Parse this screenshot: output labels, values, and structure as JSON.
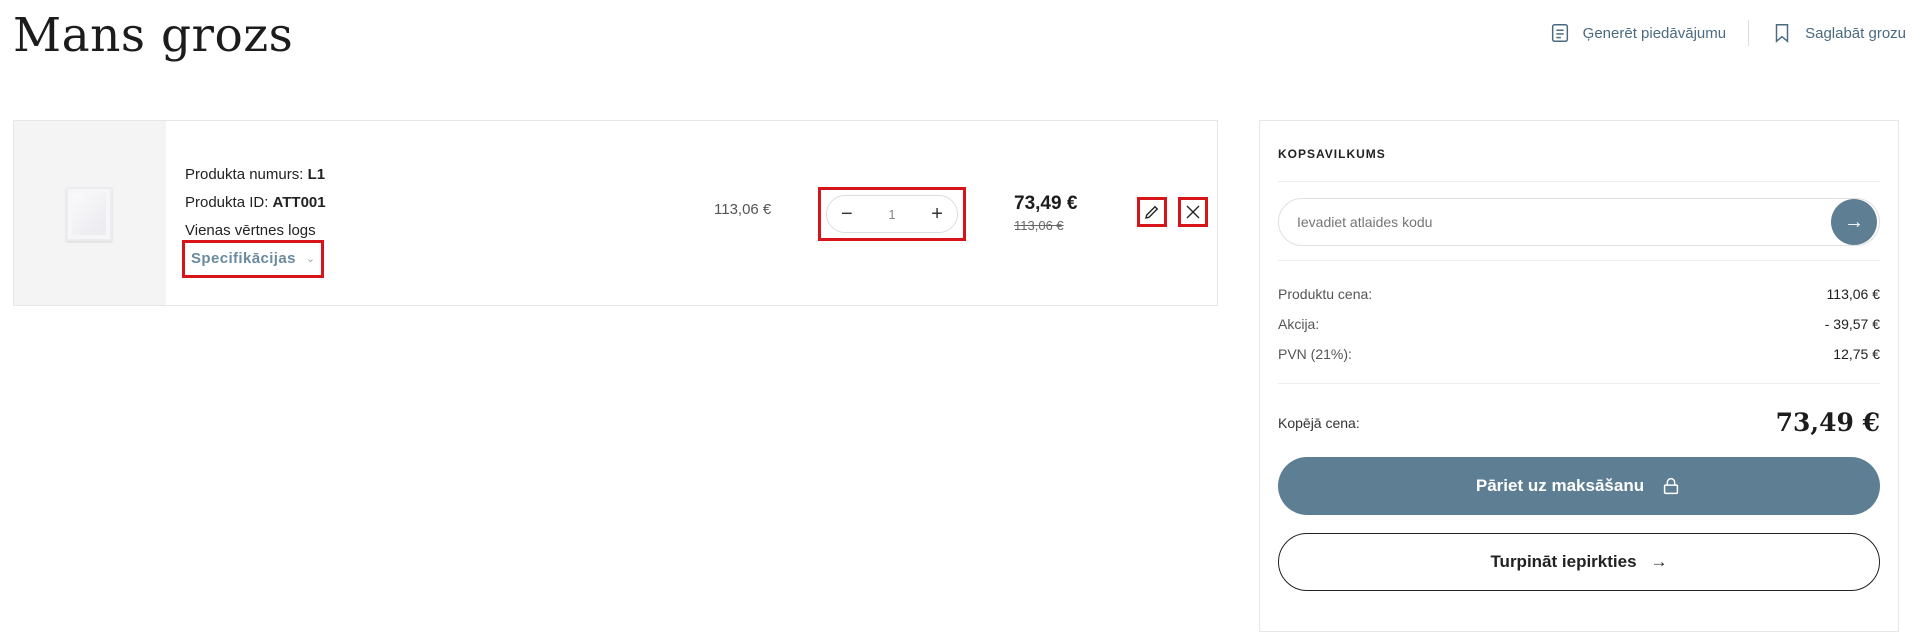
{
  "page": {
    "title": "Mans grozs"
  },
  "header_actions": {
    "generate_offer_label": "Ģenerēt piedāvājumu",
    "save_cart_label": "Saglabāt grozu"
  },
  "cart_item": {
    "product_number_label": "Produkta numurs:",
    "product_number": "L1",
    "product_id_label": "Produkta ID:",
    "product_id": "ATT001",
    "name": "Vienas vērtnes logs",
    "specs_label": "Specifikācijas",
    "unit_price": "113,06 €",
    "quantity": "1",
    "price_new": "73,49 €",
    "price_old": "113,06 €"
  },
  "summary": {
    "title": "KOPSAVILKUMS",
    "coupon_placeholder": "Ievadiet atlaides kodu",
    "lines": [
      {
        "label": "Produktu cena:",
        "value": "113,06 €"
      },
      {
        "label": "Akcija:",
        "value": "- 39,57 €"
      },
      {
        "label": "PVN (21%):",
        "value": "12,75 €"
      }
    ],
    "total_label": "Kopējā cena:",
    "total_value": "73,49 €",
    "checkout_label": "Pāriet uz maksāšanu",
    "continue_label": "Turpināt iepirkties",
    "continue_arrow": "→"
  },
  "colors": {
    "accent": "#5e7f93",
    "highlight": "#d8141b"
  }
}
